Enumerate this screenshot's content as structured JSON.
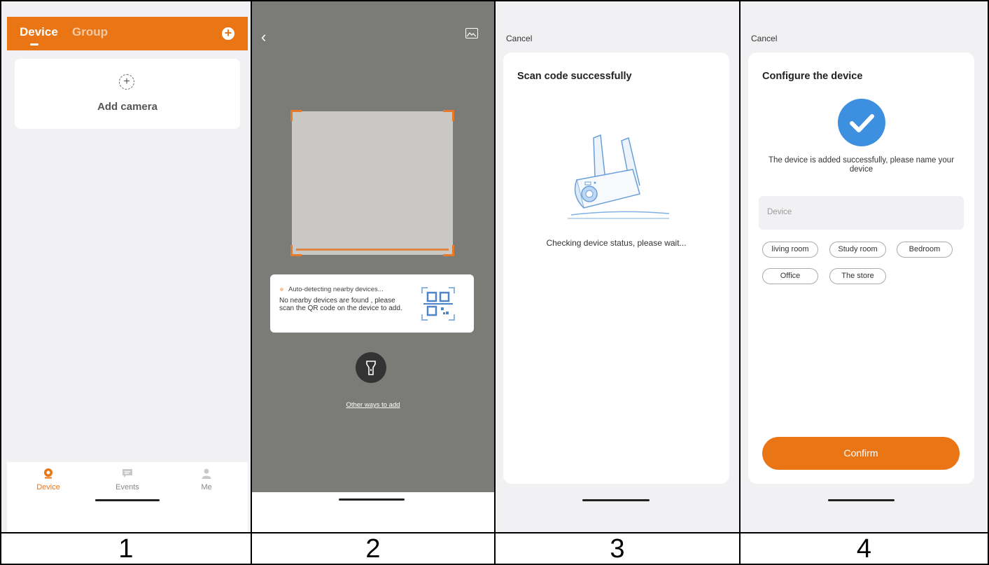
{
  "captions": [
    "1",
    "2",
    "3",
    "4"
  ],
  "screen1": {
    "tabs": [
      "Device",
      "Group"
    ],
    "add_card_label": "Add camera",
    "nav": [
      "Device",
      "Events",
      "Me"
    ],
    "colors": {
      "accent": "#ea7515"
    }
  },
  "screen2": {
    "tip_status": "Auto-detecting nearby devices...",
    "tip_message": "No nearby devices are found , please scan the QR code on the device to add.",
    "other_ways": "Other ways to add"
  },
  "screen3": {
    "cancel": "Cancel",
    "title": "Scan code successfully",
    "status": "Checking device status, please wait..."
  },
  "screen4": {
    "cancel": "Cancel",
    "title": "Configure the device",
    "message": "The device is added successfully, please name your device",
    "name_placeholder": "Device",
    "chips": [
      "living room",
      "Study room",
      "Bedroom",
      "Office",
      "The store"
    ],
    "confirm": "Confirm",
    "colors": {
      "check": "#3d8fe0"
    }
  }
}
